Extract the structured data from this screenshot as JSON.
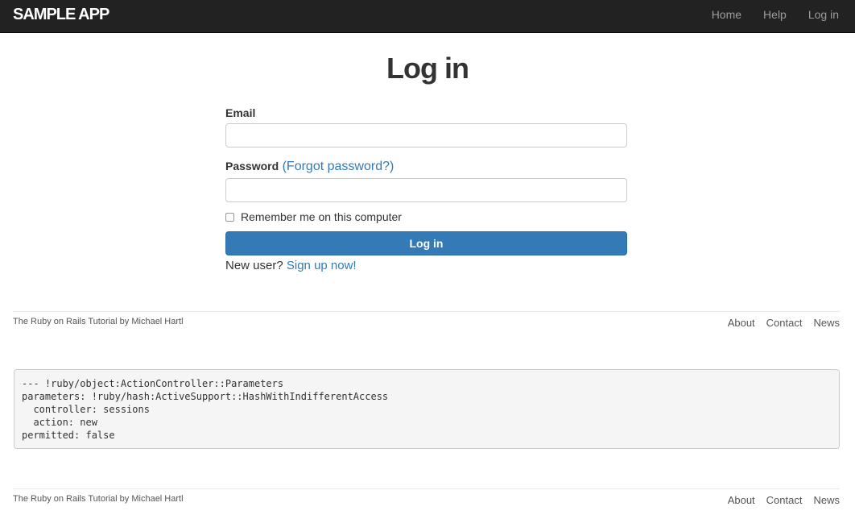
{
  "header": {
    "logo": "sample app",
    "nav": [
      {
        "label": "Home"
      },
      {
        "label": "Help"
      },
      {
        "label": "Log in"
      }
    ]
  },
  "main": {
    "title": "Log in",
    "email_label": "Email",
    "email_value": "",
    "password_label": "Password",
    "forgot_link": "(Forgot password?)",
    "password_value": "",
    "remember_label": "Remember me on this computer",
    "remember_checked": false,
    "submit_label": "Log in",
    "new_user_text": "New user?",
    "signup_link": "Sign up now!"
  },
  "footer": {
    "text": "The Ruby on Rails Tutorial by Michael Hartl",
    "links": [
      {
        "label": "About"
      },
      {
        "label": "Contact"
      },
      {
        "label": "News"
      }
    ]
  },
  "debug": {
    "lines": [
      "--- !ruby/object:ActionController::Parameters",
      "parameters: !ruby/hash:ActiveSupport::HashWithIndifferentAccess",
      "  controller: sessions",
      "  action: new",
      "permitted: false"
    ]
  },
  "colors": {
    "navbar": "#222222",
    "primary": "#337ab7",
    "link": "#337ab7"
  }
}
